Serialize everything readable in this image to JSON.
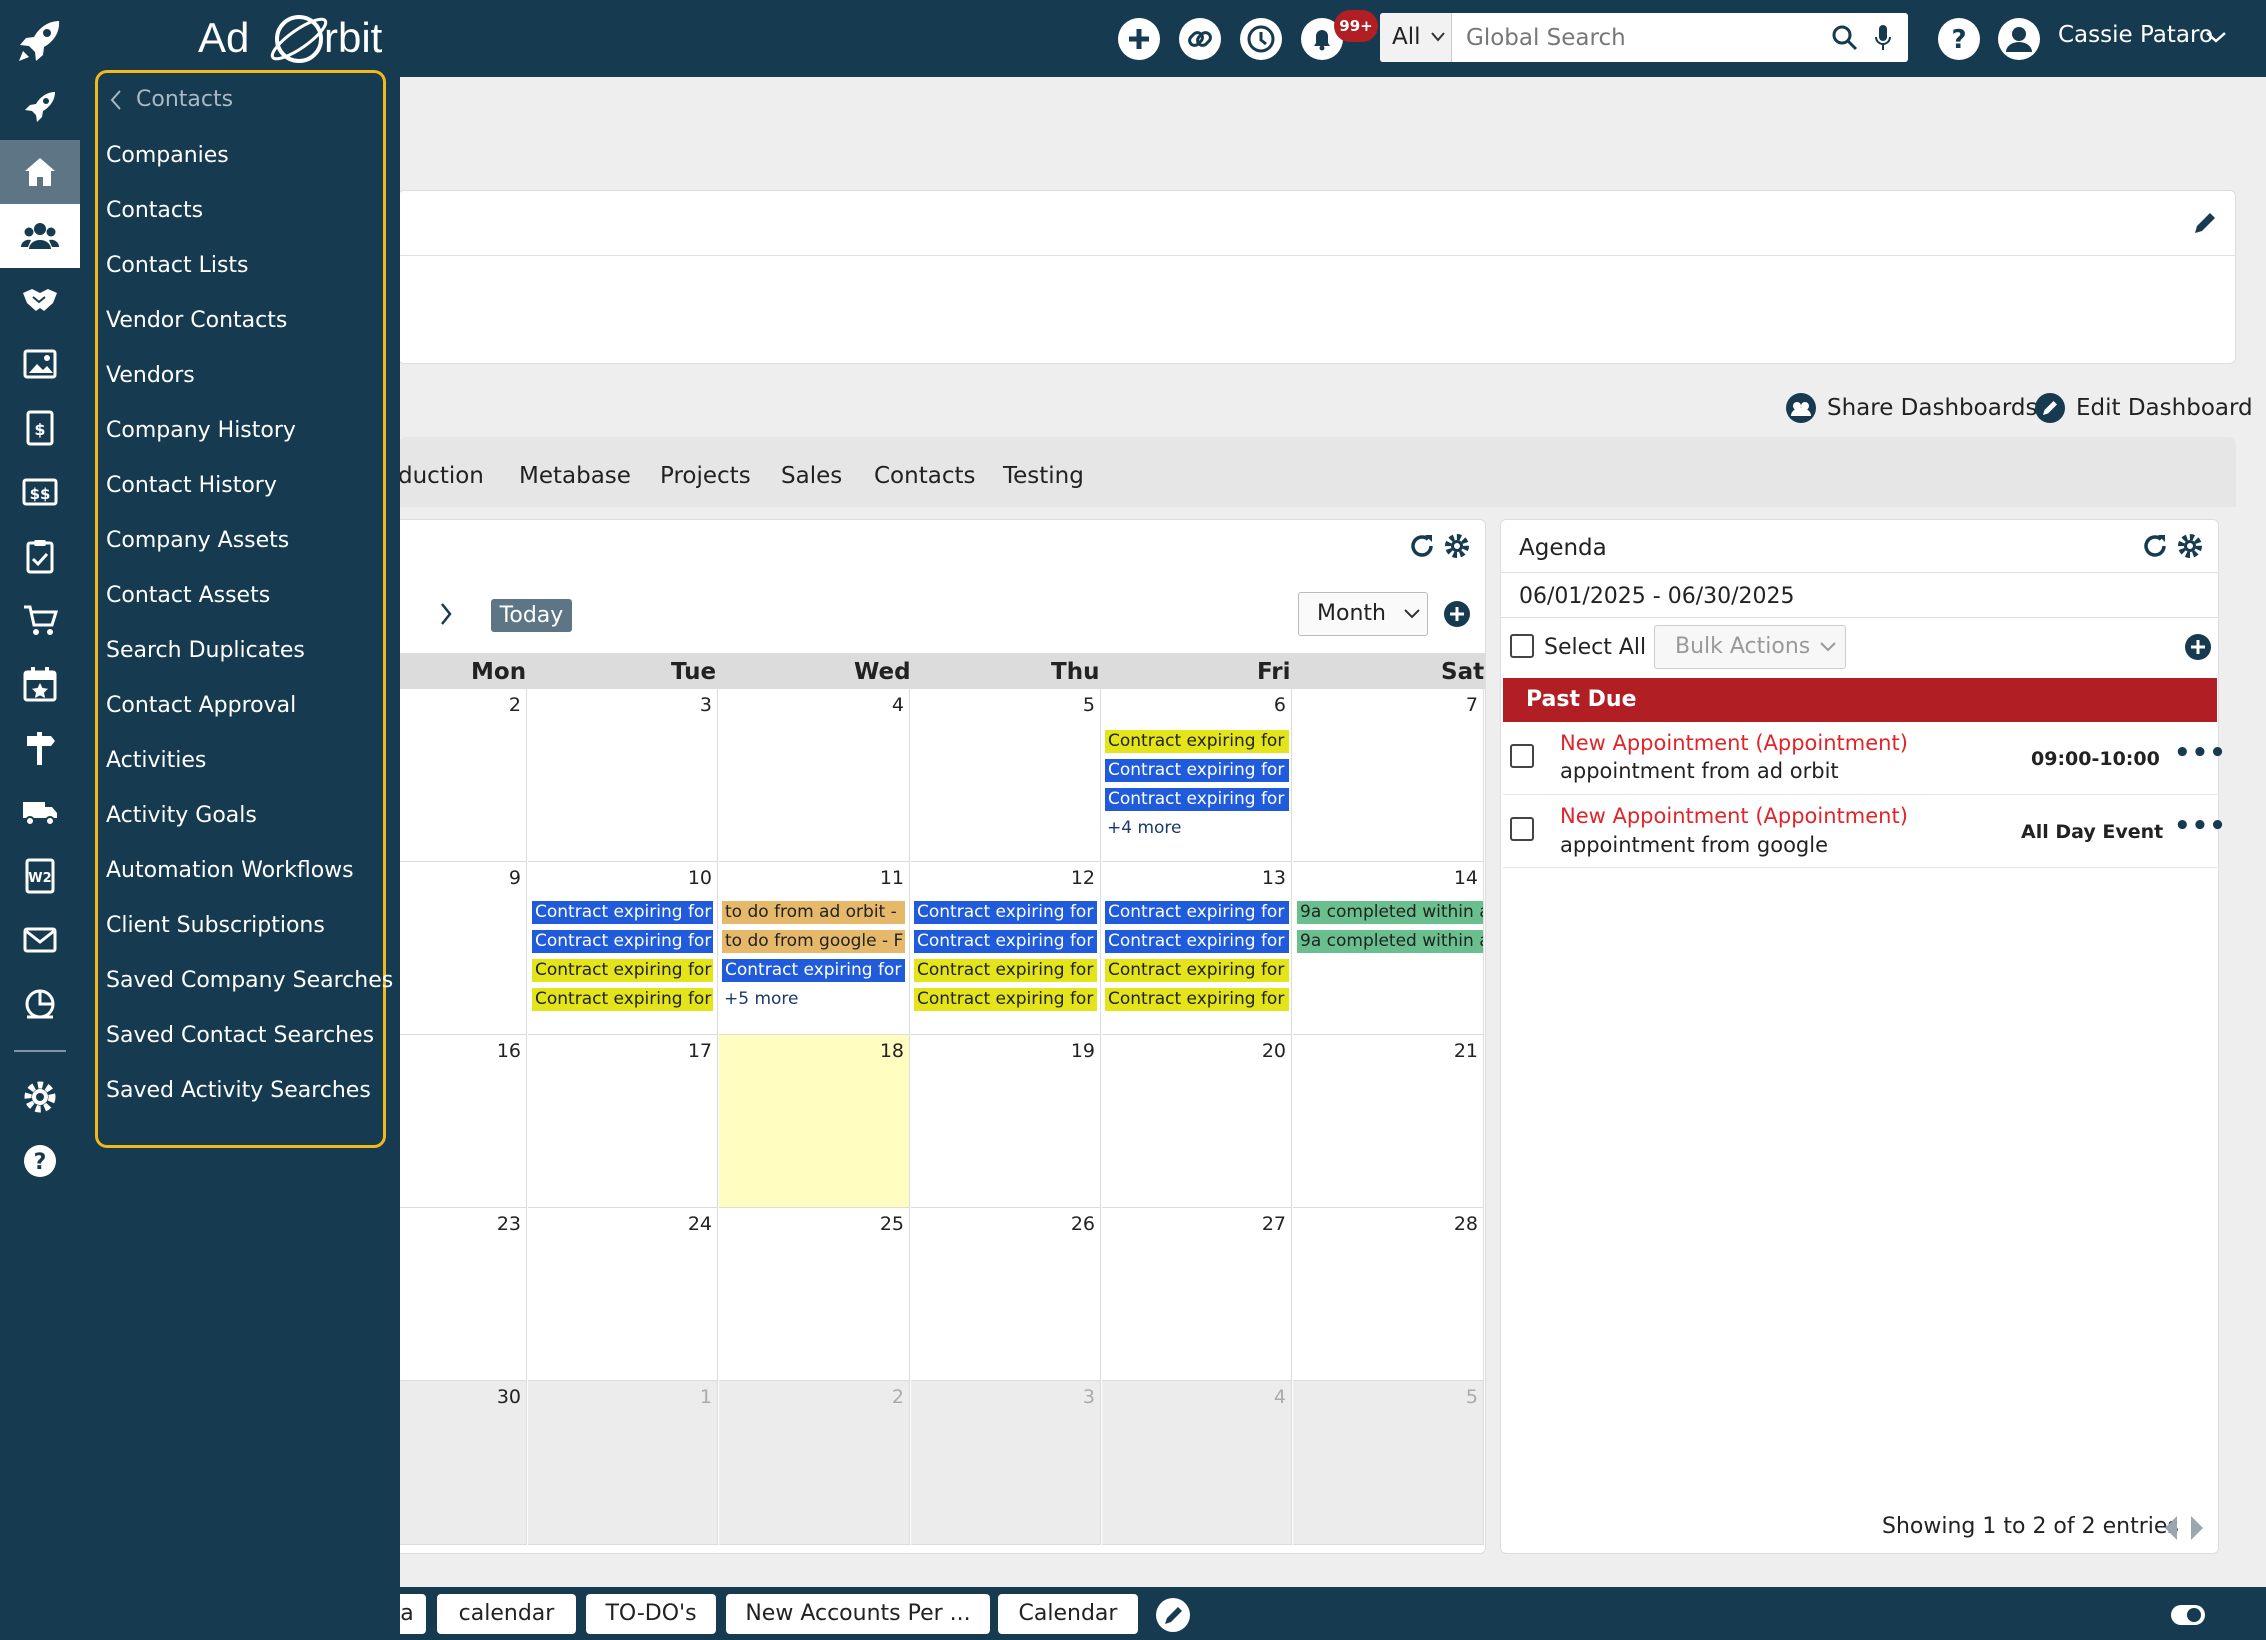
{
  "header": {
    "search_scope": "All",
    "search_placeholder": "Global Search",
    "notification_count": "99+",
    "user_name": "Cassie Pataro",
    "logo_text_left": "Ad",
    "logo_text_right": "rbit"
  },
  "flyout": {
    "back_label": "Contacts",
    "items": [
      "Companies",
      "Contacts",
      "Contact Lists",
      "Vendor Contacts",
      "Vendors",
      "Company History",
      "Contact History",
      "Company Assets",
      "Contact Assets",
      "Search Duplicates",
      "Contact Approval",
      "Activities",
      "Activity Goals",
      "Automation Workflows",
      "Client Subscriptions",
      "Saved Company Searches",
      "Saved Contact Searches",
      "Saved Activity Searches"
    ]
  },
  "dashboard": {
    "share_label": "Share Dashboards",
    "edit_label": "Edit Dashboard",
    "tabs": [
      "duction",
      "Metabase",
      "Projects",
      "Sales",
      "Contacts",
      "Testing"
    ]
  },
  "calendar": {
    "today_label": "Today",
    "view_label": "Month",
    "days": [
      "Mon",
      "Tue",
      "Wed",
      "Thu",
      "Fri",
      "Sat"
    ],
    "weeks": [
      [
        "2",
        "3",
        "4",
        "5",
        "6",
        "7"
      ],
      [
        "9",
        "10",
        "11",
        "12",
        "13",
        "14"
      ],
      [
        "16",
        "17",
        "18",
        "19",
        "20",
        "21"
      ],
      [
        "23",
        "24",
        "25",
        "26",
        "27",
        "28"
      ],
      [
        "30",
        "1",
        "2",
        "3",
        "4",
        "5"
      ]
    ],
    "events": {
      "contract": "Contract expiring for",
      "todo_adorbit": "to do from ad orbit -",
      "todo_google": "to do from google - F",
      "completed": "9a completed within a",
      "more_4": "+4 more",
      "more_5": "+5 more"
    },
    "colors": {
      "yellow": "#E4E41A",
      "blue": "#1F5BDB",
      "orange": "#E6B96A",
      "green": "#69C08E",
      "today_highlight": "#FFFDBF"
    }
  },
  "agenda": {
    "title": "Agenda",
    "date_range": "06/01/2025 - 06/30/2025",
    "select_all_label": "Select All",
    "bulk_actions_label": "Bulk Actions",
    "section_label": "Past Due",
    "items": [
      {
        "title": "New Appointment (Appointment)",
        "subtitle": "appointment from ad orbit",
        "time": "09:00-10:00"
      },
      {
        "title": "New Appointment (Appointment)",
        "subtitle": "appointment from google",
        "time": "All Day Event"
      }
    ],
    "showing_label": "Showing 1 to 2 of 2 entries"
  },
  "bottom_tabs": [
    "a",
    "calendar",
    "TO-DO's",
    "New Accounts Per ...",
    "Calendar"
  ],
  "theme": {
    "navy": "#163A50",
    "accent_yellow": "#F2B81C",
    "past_due_red": "#B11F24"
  }
}
